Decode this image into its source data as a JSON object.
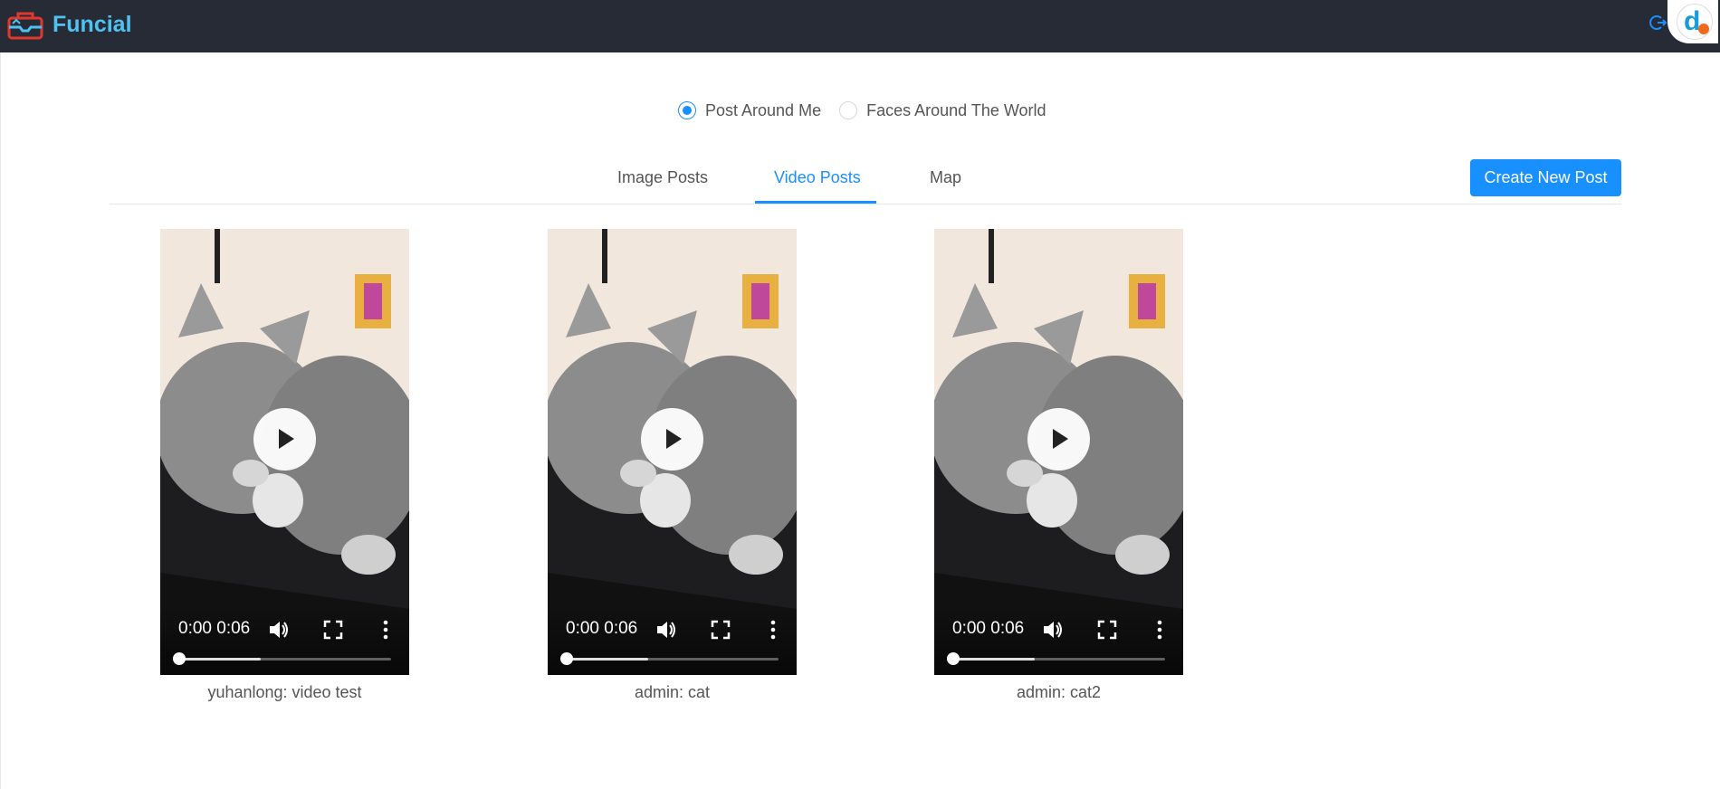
{
  "header": {
    "app_title": "Funcial",
    "logo_icon": "toolbox-icon",
    "logout_icon": "logout-icon",
    "extension_icon": "d-extension-icon"
  },
  "radio": {
    "options": [
      {
        "label": "Post Around Me",
        "checked": true
      },
      {
        "label": "Faces Around The World",
        "checked": false
      }
    ]
  },
  "tabs": {
    "items": [
      "Image Posts",
      "Video Posts",
      "Map"
    ],
    "active": "Video Posts"
  },
  "toolbar": {
    "create_label": "Create New Post"
  },
  "videos": [
    {
      "time": "0:00 0:06",
      "caption": "yuhanlong: video test",
      "buffered": 0.37
    },
    {
      "time": "0:00 0:06",
      "caption": "admin: cat",
      "buffered": 0.37
    },
    {
      "time": "0:00 0:06",
      "caption": "admin: cat2",
      "buffered": 0.37
    }
  ],
  "colors": {
    "header_bg": "#272b35",
    "accent": "#1890ff",
    "title": "#4ec3f3"
  }
}
